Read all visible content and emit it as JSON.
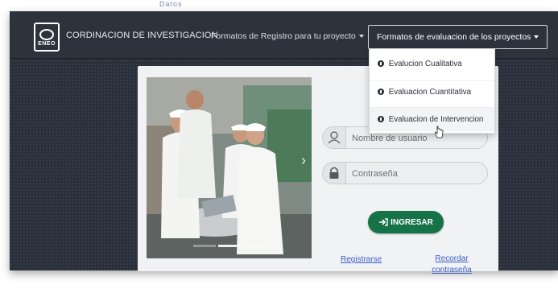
{
  "page_caption": "Datos",
  "navbar": {
    "brand": "CORDINACION DE INVESTIGACION",
    "logo_text": "ENEO",
    "registro_label": "Formatos de Registro para tu proyecto",
    "evaluacion_label": "Formatos de evaluacion de los proyectos"
  },
  "dropdown": {
    "items": [
      {
        "label": "Evalucion Cualitativa"
      },
      {
        "label": "Evaluacion Cuantitativa"
      },
      {
        "label": "Evaluacion de Intervencion"
      }
    ]
  },
  "login": {
    "username_placeholder": "Nombre de usuario",
    "password_placeholder": "Contraseña",
    "submit_label": "INGRESAR",
    "register_link": "Registrarse",
    "forgot_link_line1": "Recordar",
    "forgot_link_line2": "contraseña"
  },
  "carousel": {
    "active_slide": 2,
    "slide_count": 3
  },
  "colors": {
    "navbar_bg": "#2d333d",
    "button_green": "#157347",
    "link_blue": "#3b5fcb"
  },
  "icons": {
    "logo": "eneo-logo-icon",
    "user": "user-icon",
    "lock": "lock-icon",
    "login": "sign-in-icon",
    "bullet": "circle-bullet-icon",
    "next": "chevron-right-icon"
  }
}
